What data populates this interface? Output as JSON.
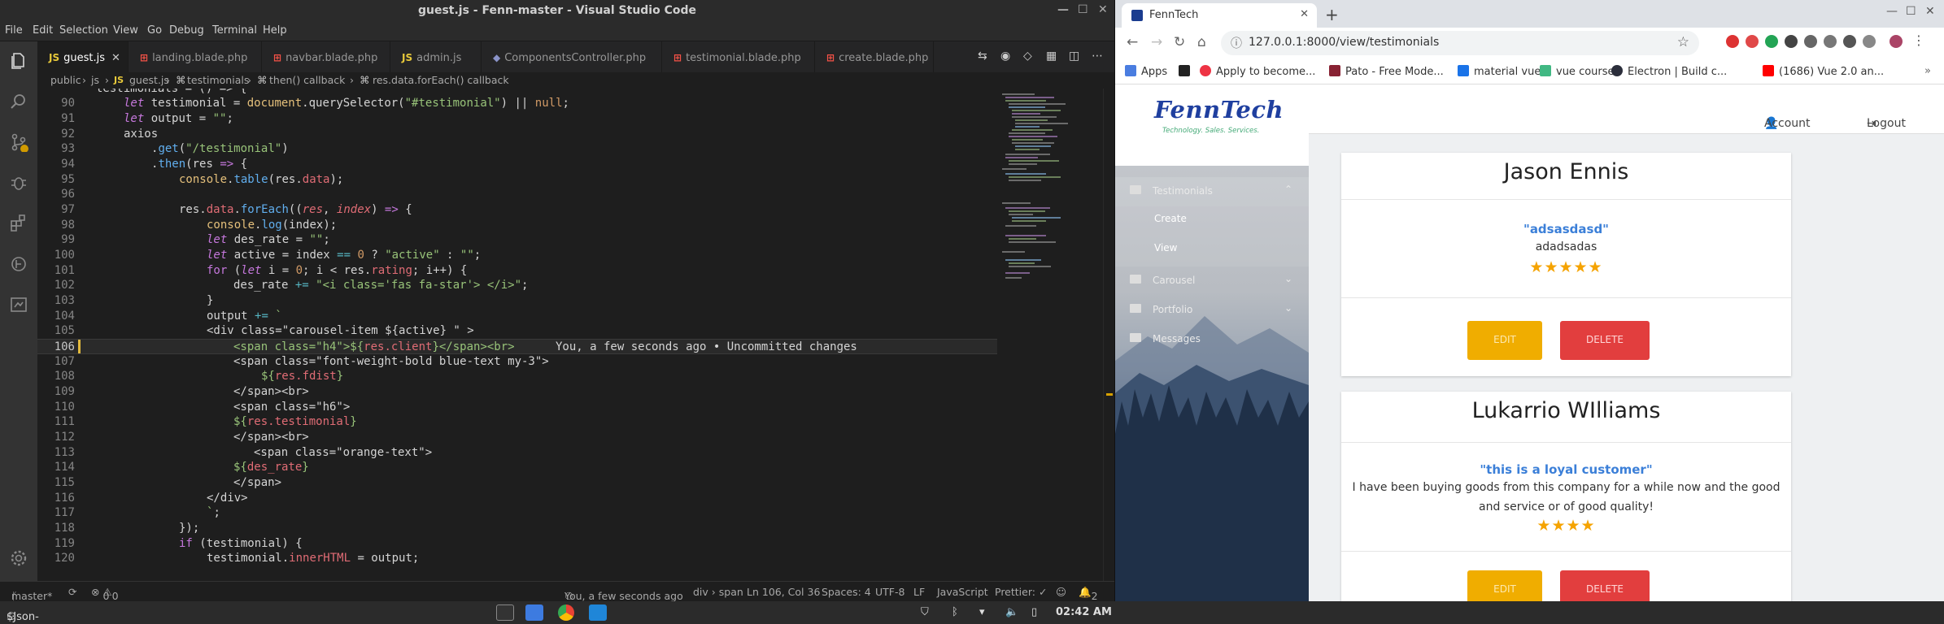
{
  "vscode": {
    "title": "guest.js - Fenn-master - Visual Studio Code",
    "menu": [
      "File",
      "Edit",
      "Selection",
      "View",
      "Go",
      "Debug",
      "Terminal",
      "Help"
    ],
    "tabs": [
      "guest.js",
      "landing.blade.php",
      "navbar.blade.php",
      "admin.js",
      "ComponentsController.php",
      "testimonial.blade.php",
      "create.blade.php"
    ],
    "breadcrumb": [
      "public",
      "js",
      "guest.js",
      "testimonials",
      "then() callback",
      "res.data.forEach() callback"
    ],
    "code_top": "testimonials = () => {",
    "blame": "You, a few seconds ago • Uncommitted changes",
    "status": {
      "branch": "master*",
      "problems": "0",
      "warnings": "0",
      "blame": "You, a few seconds ago",
      "scope": "div › span",
      "position": "Ln 106, Col 36",
      "spaces": "Spaces: 4",
      "encoding": "UTF-8",
      "eol": "LF",
      "language": "JavaScript",
      "prettier": "Prettier: ✓",
      "notifications": "2"
    },
    "lines": [
      "90",
      "91",
      "92",
      "93",
      "94",
      "95",
      "96",
      "97",
      "98",
      "99",
      "100",
      "101",
      "102",
      "103",
      "104",
      "105",
      "106",
      "107",
      "108",
      "109",
      "110",
      "111",
      "112",
      "113",
      "114",
      "115",
      "116",
      "117",
      "118",
      "119",
      "120"
    ],
    "code": {
      "l90a": "let",
      "l90b": " testimonial = ",
      "l90c": "document",
      "l90d": ".querySelector(",
      "l90e": "\"#testimonial\"",
      "l90f": ") || ",
      "l90g": "null",
      "l90h": ";",
      "l91a": "let",
      "l91b": " output = ",
      "l91c": "\"\"",
      "l91d": ";",
      "l92": "axios",
      "l93a": ".",
      "l93b": "get",
      "l93c": "(",
      "l93d": "\"/testimonial\"",
      "l93e": ")",
      "l94a": ".",
      "l94b": "then",
      "l94c": "(res ",
      "l94d": "=>",
      "l94e": " {",
      "l95a": "console",
      "l95b": ".",
      "l95c": "table",
      "l95d": "(res.",
      "l95e": "data",
      "l95f": ");",
      "l97a": "res.",
      "l97b": "data",
      "l97c": ".",
      "l97d": "forEach",
      "l97e": "((",
      "l97f": "res",
      "l97g": ", ",
      "l97h": "index",
      "l97i": ") ",
      "l97j": "=>",
      "l97k": " {",
      "l98a": "console",
      "l98b": ".",
      "l98c": "log",
      "l98d": "(index);",
      "l99a": "let",
      "l99b": " des_rate = ",
      "l99c": "\"\"",
      "l99d": ";",
      "l100a": "let",
      "l100b": " active = index ",
      "l100c": "==",
      "l100d": " ",
      "l100e": "0",
      "l100f": " ? ",
      "l100g": "\"active\"",
      "l100h": " : ",
      "l100i": "\"\"",
      "l100j": ";",
      "l101a": "for",
      "l101b": " (",
      "l101c": "let",
      "l101d": " i = ",
      "l101e": "0",
      "l101f": "; i < res.",
      "l101g": "rating",
      "l101h": "; i++) {",
      "l102a": "des_rate ",
      "l102b": "+=",
      "l102c": " ",
      "l102d": "\"<i class='fas fa-star'> </i>\"",
      "l102e": ";",
      "l103": "}",
      "l104a": "output ",
      "l104b": "+=",
      "l104c": " ",
      "l104d": "`",
      "l105": "<div class=\"carousel-item ${active} \" >",
      "l106a": "<span class=\"h4\">${",
      "l106b": "res.client",
      "l106c": "}</span><br>",
      "l107": "<span class=\"font-weight-bold blue-text my-3\">",
      "l108a": "${",
      "l108b": "res.fdist",
      "l108c": "}",
      "l109": "</span><br>",
      "l110": "<span class=\"h6\">",
      "l111a": "${",
      "l111b": "res.testimonial",
      "l111c": "}",
      "l112": "</span><br>",
      "l113": "<span class=\"orange-text\">",
      "l114a": "${",
      "l114b": "des_rate",
      "l114c": "}",
      "l115": "</span>",
      "l116": "</div>",
      "l117a": "`",
      "l117b": ";",
      "l118": "});",
      "l119a": "if",
      "l119b": " (testimonial) {",
      "l120a": "testimonial.",
      "l120b": "innerHTML",
      "l120c": " = output;"
    }
  },
  "chrome": {
    "tab_title": "FennTech",
    "url": "127.0.0.1:8000/view/testimonials",
    "bookmarks": [
      "Apps",
      "Apply to become...",
      "Pato - Free Mode...",
      "material vue",
      "vue course",
      "Electron | Build c...",
      "(1686) Vue 2.0 an..."
    ]
  },
  "site": {
    "logo": "FennTech",
    "tagline": "Technology. Sales. Services.",
    "nav": {
      "account": "Account",
      "logout": "Logout"
    },
    "menu": {
      "testimonials": "Testimonials",
      "create": "Create",
      "view": "View",
      "carousel": "Carousel",
      "portfolio": "Portfolio",
      "messages": "Messages"
    },
    "cards": [
      {
        "name": "Jason Ennis",
        "quote": "\"adsasdasd\"",
        "text": "adadsadas",
        "stars": "★★★★★",
        "edit": "EDIT",
        "delete": "DELETE"
      },
      {
        "name": "Lukarrio WIlliams",
        "quote": "\"this is a loyal customer\"",
        "text": "I have been buying goods from this company for a while now and the good and service or of good quality!",
        "stars": "★★★★",
        "edit": "EDIT",
        "delete": "DELETE"
      }
    ]
  },
  "taskbar": {
    "user": "$Json-Dev",
    "time": "02:42 AM"
  },
  "colors": {
    "vscode_bg": "#1e1e1e",
    "accent_blue": "#3b7fd8",
    "star": "#f5a300",
    "edit": "#f0ad00",
    "delete": "#e23e3e"
  }
}
